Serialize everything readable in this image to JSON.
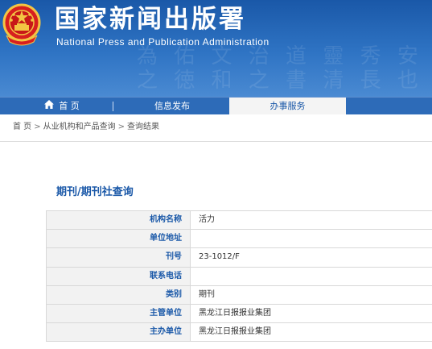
{
  "header": {
    "title_cn": "国家新闻出版署",
    "title_en": "National  Press and Publication Administration",
    "deco_lines": [
      "為 佑 文 治 道 靈 秀 安 山 傳",
      "之 徳 和 之 書 清 長 也 悉 美"
    ]
  },
  "nav": {
    "home": "首 页",
    "info": "信息发布",
    "service": "办事服务"
  },
  "breadcrumb": {
    "items": [
      "首 页",
      "从业机构和产品查询",
      "查询结果"
    ],
    "separator": ">"
  },
  "section": {
    "title": "期刊/期刊社查询"
  },
  "table": {
    "rows": [
      {
        "label": "机构名称",
        "value": "活力"
      },
      {
        "label": "单位地址",
        "value": ""
      },
      {
        "label": "刊号",
        "value": "23-1012/F"
      },
      {
        "label": "联系电话",
        "value": ""
      },
      {
        "label": "类别",
        "value": "期刊"
      },
      {
        "label": "主管单位",
        "value": "黑龙江日报报业集团"
      },
      {
        "label": "主办单位",
        "value": "黑龙江日报报业集团"
      }
    ]
  },
  "colors": {
    "brand_blue": "#1a58a8",
    "nav_blue": "#2d6bb8",
    "emblem_red": "#d71f1f",
    "emblem_gold": "#f3c543"
  }
}
